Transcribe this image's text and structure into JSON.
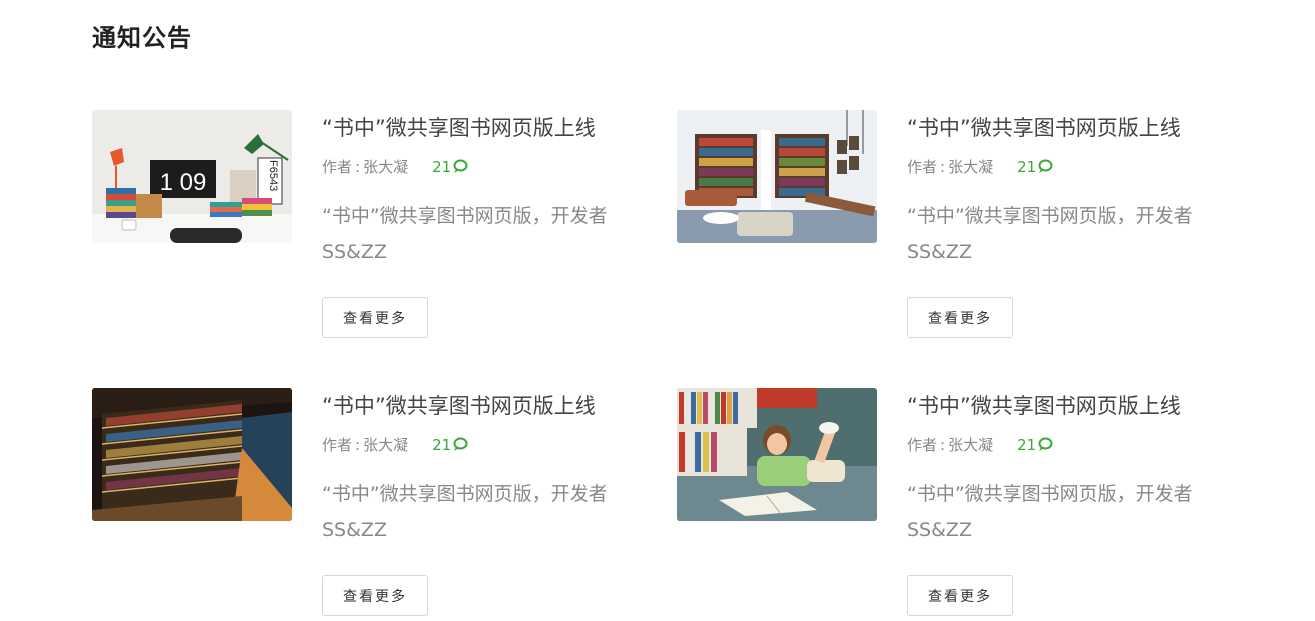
{
  "section": {
    "title": "通知公告"
  },
  "notices": [
    {
      "title": "“书中”微共享图书网页版上线",
      "author_label": "作者",
      "author_separator": ":",
      "author_name": "张大凝",
      "comment_count": "21",
      "summary": "“书中”微共享图书网页版，开发者SS&ZZ",
      "button_label": "查看更多",
      "image": "desk-with-books-and-clock-photo"
    },
    {
      "title": "“书中”微共享图书网页版上线",
      "author_label": "作者",
      "author_separator": ":",
      "author_name": "张大凝",
      "comment_count": "21",
      "summary": "“书中”微共享图书网页版，开发者SS&ZZ",
      "button_label": "查看更多",
      "image": "library-living-room-photo"
    },
    {
      "title": "“书中”微共享图书网页版上线",
      "author_label": "作者",
      "author_separator": ":",
      "author_name": "张大凝",
      "comment_count": "21",
      "summary": "“书中”微共享图书网页版，开发者SS&ZZ",
      "button_label": "查看更多",
      "image": "bookstore-shelves-stairs-photo"
    },
    {
      "title": "“书中”微共享图书网页版上线",
      "author_label": "作者",
      "author_separator": ":",
      "author_name": "张大凝",
      "comment_count": "21",
      "summary": "“书中”微共享图书网页版，开发者SS&ZZ",
      "button_label": "查看更多",
      "image": "girl-reading-on-floor-photo"
    }
  ],
  "photo_text": {
    "clock": "1 09",
    "poster": "F6543"
  },
  "colors": {
    "comment_green": "#3aa83a",
    "title_text": "#444444",
    "muted_text": "#888888"
  },
  "icons": {
    "comment": "speech-bubble-icon"
  }
}
